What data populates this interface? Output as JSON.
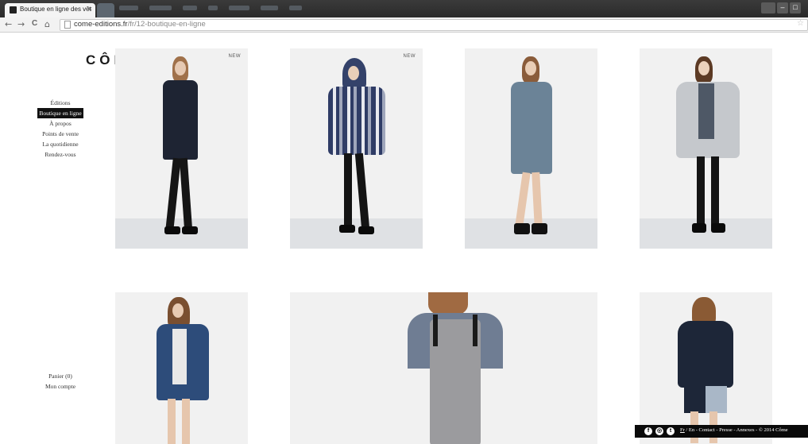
{
  "browser": {
    "tab_title": "Boutique en ligne des vêt",
    "tab_close": "×",
    "url_domain": "come-editions.fr",
    "url_path": "/fr/12-boutique-en-ligne",
    "back_glyph": "←",
    "forward_glyph": "→",
    "reload_glyph": "C",
    "home_glyph": "⌂",
    "star_glyph": "☆",
    "minimize_glyph": "–",
    "maximize_glyph": "□"
  },
  "site": {
    "logo": "CÔME",
    "menu": [
      {
        "label": "Éditions",
        "active": false
      },
      {
        "label": "Boutique en ligne",
        "active": true
      },
      {
        "label": "À propos",
        "active": false
      },
      {
        "label": "Points de vente",
        "active": false
      },
      {
        "label": "La quotidienne",
        "active": false
      },
      {
        "label": "Rendez-vous",
        "active": false
      }
    ],
    "cart_label": "Panier (0)",
    "account_label": "Mon compte"
  },
  "products": [
    {
      "badge": "NEW"
    },
    {
      "badge": "NEW"
    },
    {
      "badge": ""
    },
    {
      "badge": ""
    },
    {
      "badge": ""
    },
    {
      "badge": ""
    },
    {
      "badge": ""
    }
  ],
  "footer": {
    "icons": [
      "facebook-icon",
      "instagram-icon",
      "twitter-icon"
    ],
    "icon_glyphs": [
      "f",
      "◎",
      "t"
    ],
    "lang_fr": "Fr",
    "sep": " / ",
    "lang_en": "En",
    "links_text": " - Contact - Presse - Annexes - © 2014 Côme"
  },
  "colors": {
    "accent": "#111111",
    "footer_bg": "#0a0a0a",
    "photo_bg": "#f1f1f1"
  }
}
